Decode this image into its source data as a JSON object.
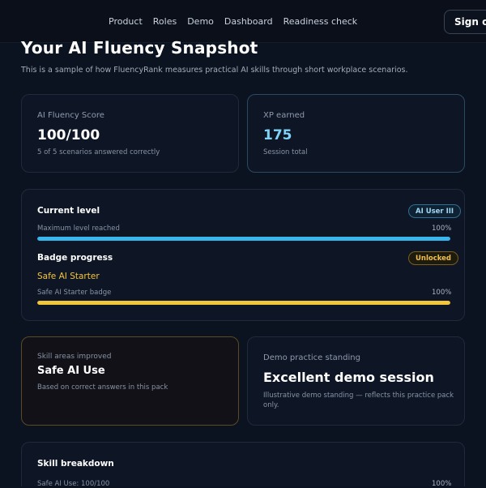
{
  "nav": {
    "links": [
      "Product",
      "Roles",
      "Demo",
      "Dashboard",
      "Readiness check"
    ],
    "sign_in": "Sign on"
  },
  "page": {
    "title": "Your AI Fluency Snapshot",
    "subtitle": "This is a sample of how FluencyRank measures practical AI skills through short workplace scenarios."
  },
  "score_card": {
    "label": "AI Fluency Score",
    "value": "100/100",
    "detail": "5 of 5 scenarios answered correctly"
  },
  "xp_card": {
    "label": "XP earned",
    "value": "175",
    "detail": "Session total"
  },
  "progress": {
    "level": {
      "title": "Current level",
      "badge": "AI User III",
      "caption": "Maximum level reached",
      "percent_label": "100%",
      "percent": 100
    },
    "badge": {
      "title": "Badge progress",
      "status": "Unlocked",
      "name": "Safe AI Starter",
      "caption": "Safe AI Starter badge",
      "percent_label": "100%",
      "percent": 100
    }
  },
  "skill_card": {
    "label": "Skill areas improved",
    "value": "Safe AI Use",
    "detail": "Based on correct answers in this pack"
  },
  "standing_card": {
    "label": "Demo practice standing",
    "value": "Excellent demo session",
    "detail_line1": "Illustrative demo standing — reflects this practice pack",
    "detail_line2": "only."
  },
  "breakdown": {
    "title": "Skill breakdown",
    "row_label": "Safe AI Use: 100/100",
    "row_percent_label": "100%"
  },
  "colors": {
    "accent_blue": "#38b7ee",
    "accent_gold": "#f3c53c",
    "xp_value": "#7fd3f7"
  }
}
